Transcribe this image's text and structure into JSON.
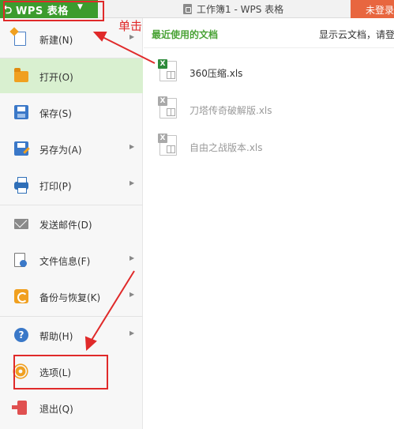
{
  "titlebar": {
    "app_name": "WPS 表格",
    "document_title": "工作簿1 - WPS 表格",
    "login_label": "未登录"
  },
  "menu": {
    "items": [
      {
        "label": "新建(N)",
        "icon": "new-icon",
        "has_submenu": true
      },
      {
        "label": "打开(O)",
        "icon": "folder-open-icon",
        "has_submenu": false,
        "active": true
      },
      {
        "label": "保存(S)",
        "icon": "save-icon",
        "has_submenu": false
      },
      {
        "label": "另存为(A)",
        "icon": "save-as-icon",
        "has_submenu": true
      },
      {
        "label": "打印(P)",
        "icon": "printer-icon",
        "has_submenu": true
      },
      {
        "label": "发送邮件(D)",
        "icon": "mail-icon",
        "has_submenu": false
      },
      {
        "label": "文件信息(F)",
        "icon": "file-info-icon",
        "has_submenu": true
      },
      {
        "label": "备份与恢复(K)",
        "icon": "backup-icon",
        "has_submenu": true
      },
      {
        "label": "帮助(H)",
        "icon": "help-icon",
        "has_submenu": true
      },
      {
        "label": "选项(L)",
        "icon": "gear-icon",
        "has_submenu": false
      },
      {
        "label": "退出(Q)",
        "icon": "exit-icon",
        "has_submenu": false
      }
    ]
  },
  "recent": {
    "title": "最近使用的文档",
    "cloud_toggle": "显示云文档，请登录",
    "files": [
      {
        "name": "360压缩.xls",
        "state": "available"
      },
      {
        "name": "刀塔传奇破解版.xls",
        "state": "unavailable"
      },
      {
        "name": "自由之战版本.xls",
        "state": "unavailable"
      }
    ]
  },
  "annotation": {
    "click_text": "单击",
    "color": "#e02a2a"
  },
  "colors": {
    "brand_green": "#3c9c2e",
    "login_orange": "#e8663f",
    "active_item_bg": "#d9f0d0",
    "recent_title_green": "#4aa336"
  }
}
